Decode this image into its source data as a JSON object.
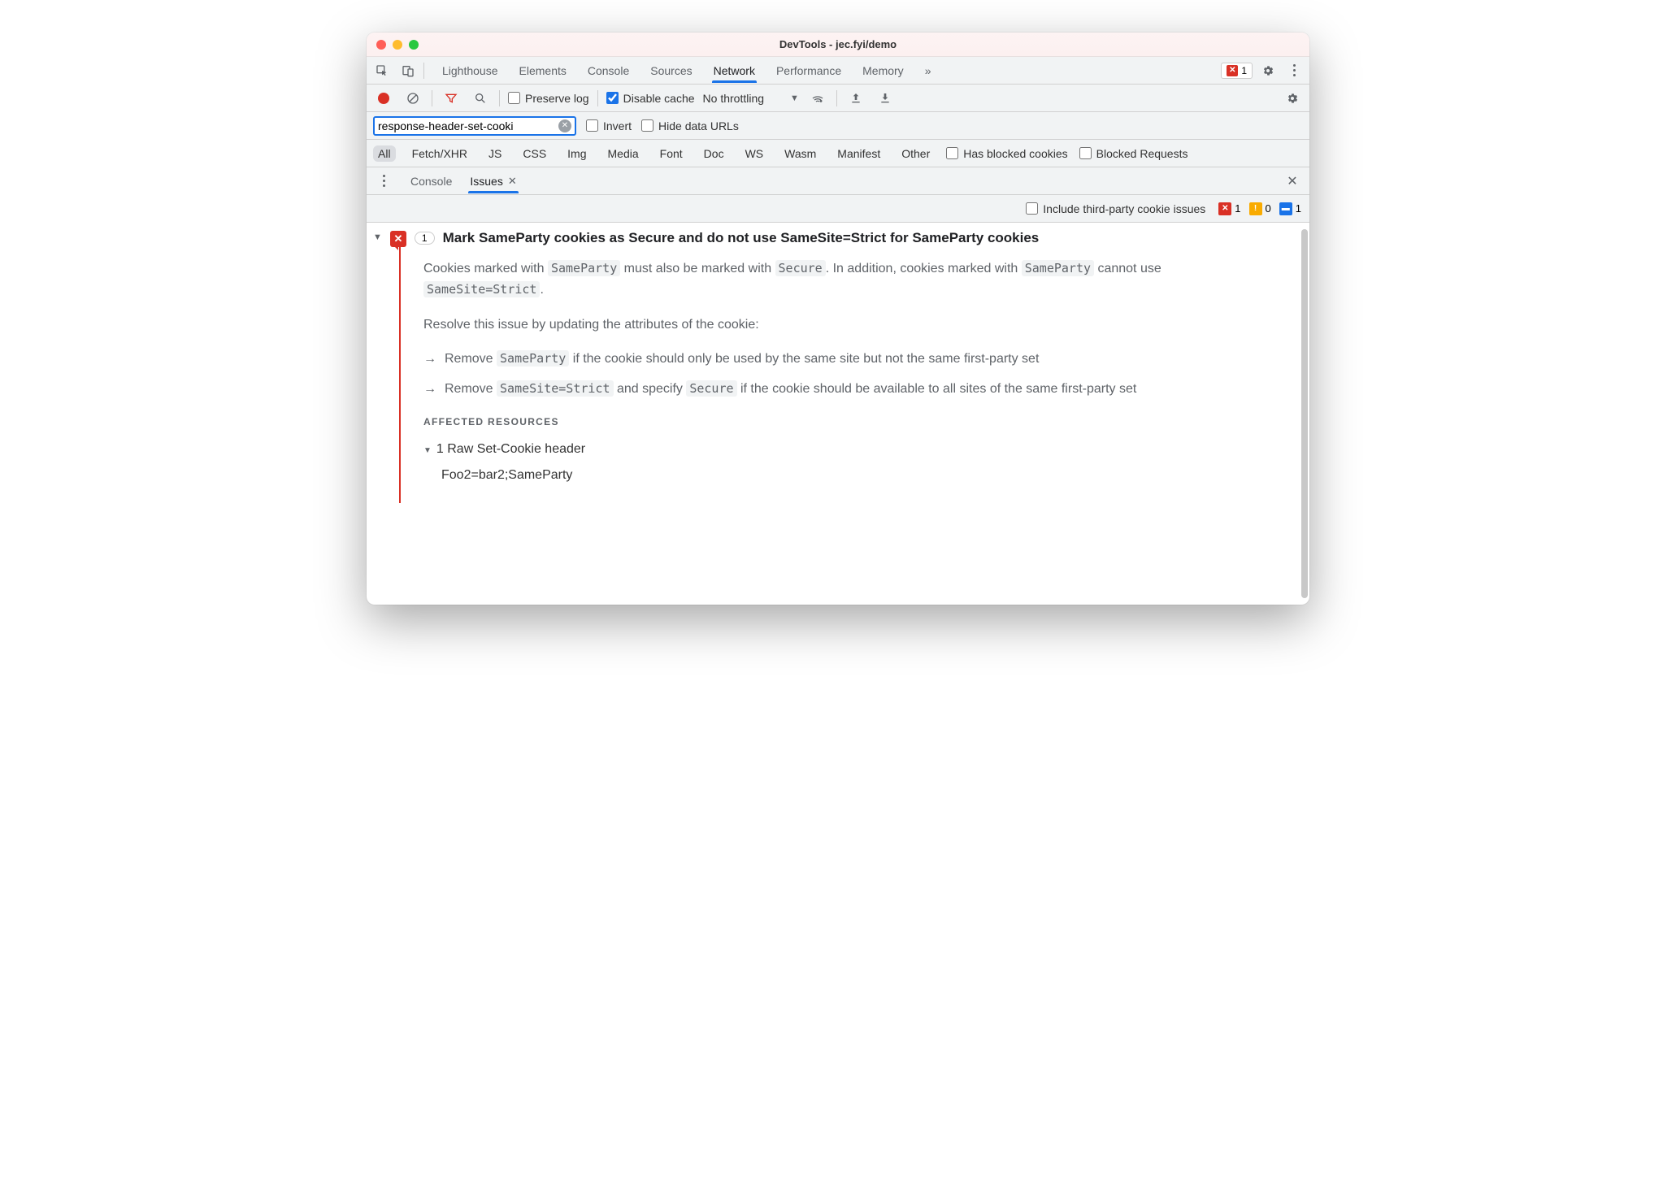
{
  "window": {
    "title": "DevTools - jec.fyi/demo"
  },
  "mainTabs": {
    "items": [
      "Lighthouse",
      "Elements",
      "Console",
      "Sources",
      "Network",
      "Performance",
      "Memory"
    ],
    "active": "Network",
    "overflow": "»",
    "errorCount": "1"
  },
  "toolbar": {
    "preserveLog": "Preserve log",
    "disableCache": "Disable cache",
    "disableCacheChecked": true,
    "throttling": "No throttling"
  },
  "filter": {
    "value": "response-header-set-cooki",
    "invert": "Invert",
    "hideData": "Hide data URLs"
  },
  "chips": {
    "items": [
      "All",
      "Fetch/XHR",
      "JS",
      "CSS",
      "Img",
      "Media",
      "Font",
      "Doc",
      "WS",
      "Wasm",
      "Manifest",
      "Other"
    ],
    "active": "All",
    "hasBlocked": "Has blocked cookies",
    "blockedReq": "Blocked Requests"
  },
  "drawer": {
    "tabs": {
      "console": "Console",
      "issues": "Issues"
    }
  },
  "issuesHeader": {
    "includeThirdParty": "Include third-party cookie issues",
    "counts": {
      "errors": "1",
      "warnings": "0",
      "info": "1"
    }
  },
  "issue": {
    "count": "1",
    "title": "Mark SameParty cookies as Secure and do not use SameSite=Strict for SameParty cookies",
    "desc_pre": "Cookies marked with ",
    "desc_mid1": " must also be marked with ",
    "desc_mid2": ". In addition, cookies marked with ",
    "desc_mid3": " cannot use ",
    "code_sameparty": "SameParty",
    "code_secure": "Secure",
    "code_samesite": "SameSite=Strict",
    "resolve": "Resolve this issue by updating the attributes of the cookie:",
    "b1_pre": "Remove ",
    "b1_post": " if the cookie should only be used by the same site but not the same first-party set",
    "b2_pre": "Remove ",
    "b2_mid": " and specify ",
    "b2_post": " if the cookie should be available to all sites of the same first-party set",
    "affected": "AFFECTED RESOURCES",
    "rawHeader": "1 Raw Set-Cookie header",
    "cookie": "Foo2=bar2;SameParty"
  }
}
